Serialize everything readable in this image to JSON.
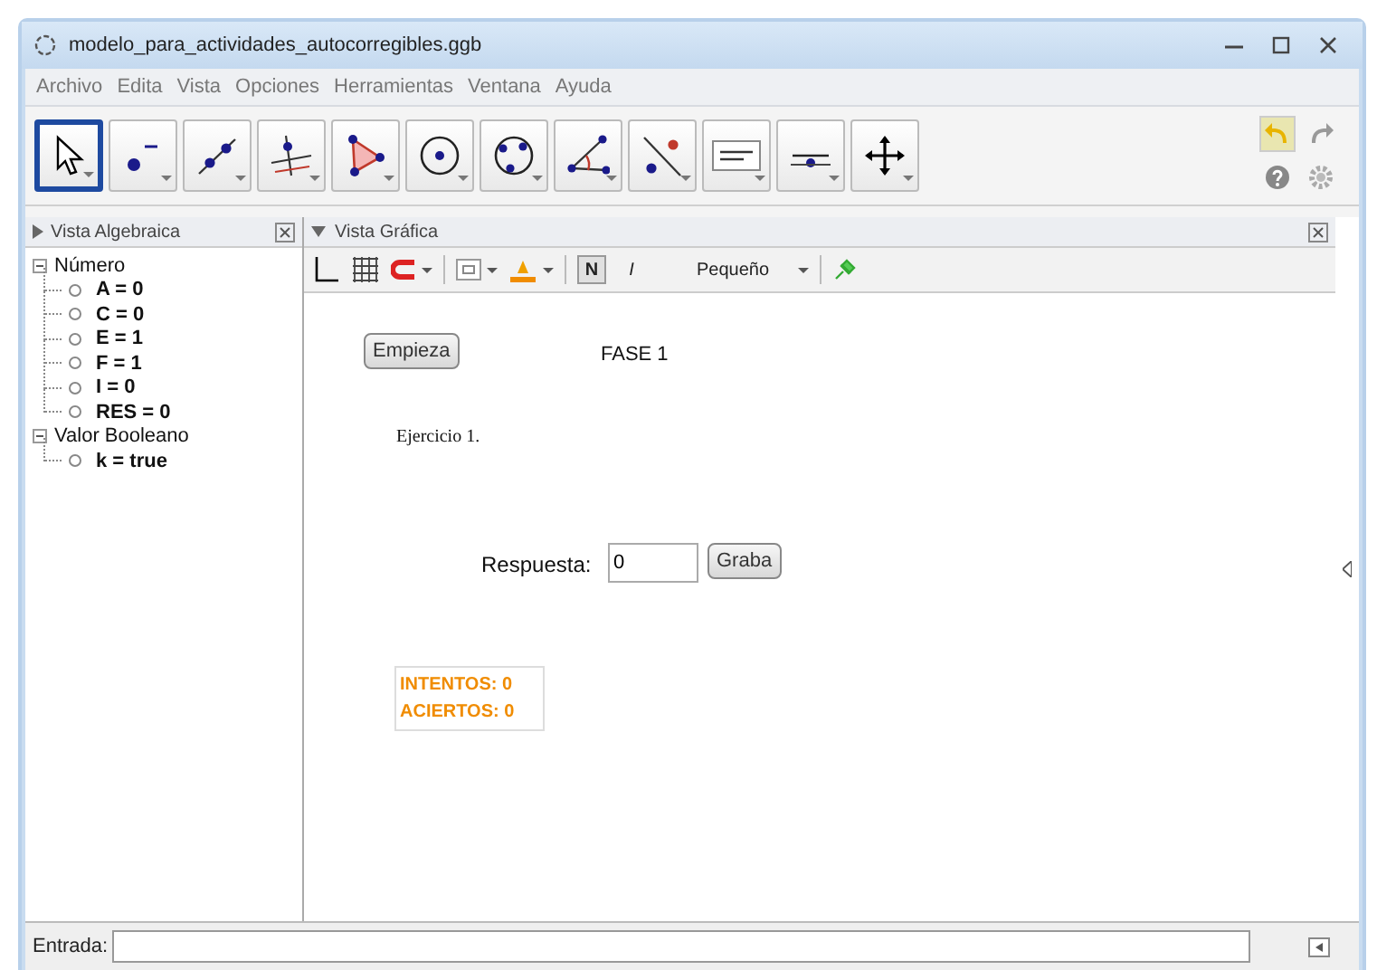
{
  "window": {
    "title": "modelo_para_actividades_autocorregibles.ggb"
  },
  "menu": [
    "Archivo",
    "Edita",
    "Vista",
    "Opciones",
    "Herramientas",
    "Ventana",
    "Ayuda"
  ],
  "toolbar": {
    "tools": [
      {
        "kind": "move",
        "selected": true
      },
      {
        "kind": "point",
        "selected": false
      },
      {
        "kind": "line",
        "selected": false
      },
      {
        "kind": "perpendicular",
        "selected": false
      },
      {
        "kind": "polygon",
        "selected": false
      },
      {
        "kind": "circle",
        "selected": false
      },
      {
        "kind": "conic",
        "selected": false
      },
      {
        "kind": "angle",
        "selected": false
      },
      {
        "kind": "reflect",
        "selected": false
      },
      {
        "kind": "text",
        "selected": false
      },
      {
        "kind": "slider",
        "selected": false
      },
      {
        "kind": "pan",
        "selected": false
      }
    ]
  },
  "algebra_view": {
    "title": "Vista Algebraica",
    "groups": [
      {
        "label": "Número",
        "expanded": true,
        "children": [
          {
            "label": "A = 0",
            "shown": false
          },
          {
            "label": "C = 0",
            "shown": false
          },
          {
            "label": "E = 1",
            "shown": false
          },
          {
            "label": "F = 1",
            "shown": false
          },
          {
            "label": "I = 0",
            "shown": false
          },
          {
            "label": "RES = 0",
            "shown": false
          }
        ]
      },
      {
        "label": "Valor Booleano",
        "expanded": true,
        "children": [
          {
            "label": "k = true",
            "shown": false
          }
        ]
      }
    ]
  },
  "graphics_view": {
    "title": "Vista Gráfica",
    "style_bar": {
      "bold_label": "N",
      "bold": true,
      "italic_label": "I",
      "italic": false,
      "size": "Pequeño"
    },
    "canvas": {
      "start_button": "Empieza",
      "phase": "FASE 1",
      "exercise": "Ejercicio 1.",
      "answer_label": "Respuesta:",
      "answer_value": "0",
      "save_button": "Graba",
      "score": [
        "INTENTOS: 0",
        "ACIERTOS: 0"
      ]
    }
  },
  "input_bar": {
    "label": "Entrada:"
  }
}
